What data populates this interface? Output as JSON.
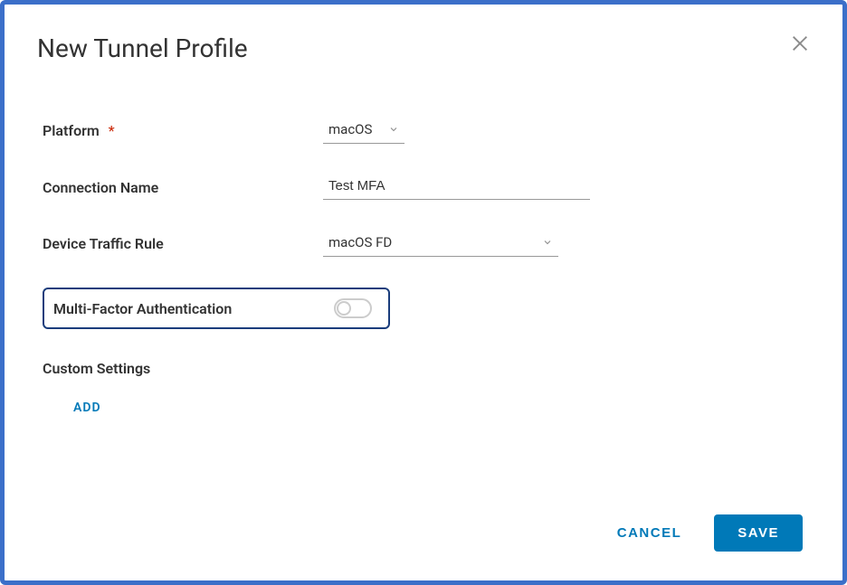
{
  "dialog": {
    "title": "New Tunnel Profile"
  },
  "form": {
    "platform": {
      "label": "Platform",
      "required": true,
      "value": "macOS"
    },
    "connection_name": {
      "label": "Connection Name",
      "value": "Test MFA"
    },
    "device_traffic_rule": {
      "label": "Device Traffic Rule",
      "value": "macOS FD"
    },
    "mfa": {
      "label": "Multi-Factor Authentication",
      "enabled": false
    },
    "custom_settings": {
      "title": "Custom Settings",
      "add_label": "ADD"
    }
  },
  "footer": {
    "cancel_label": "CANCEL",
    "save_label": "SAVE"
  }
}
